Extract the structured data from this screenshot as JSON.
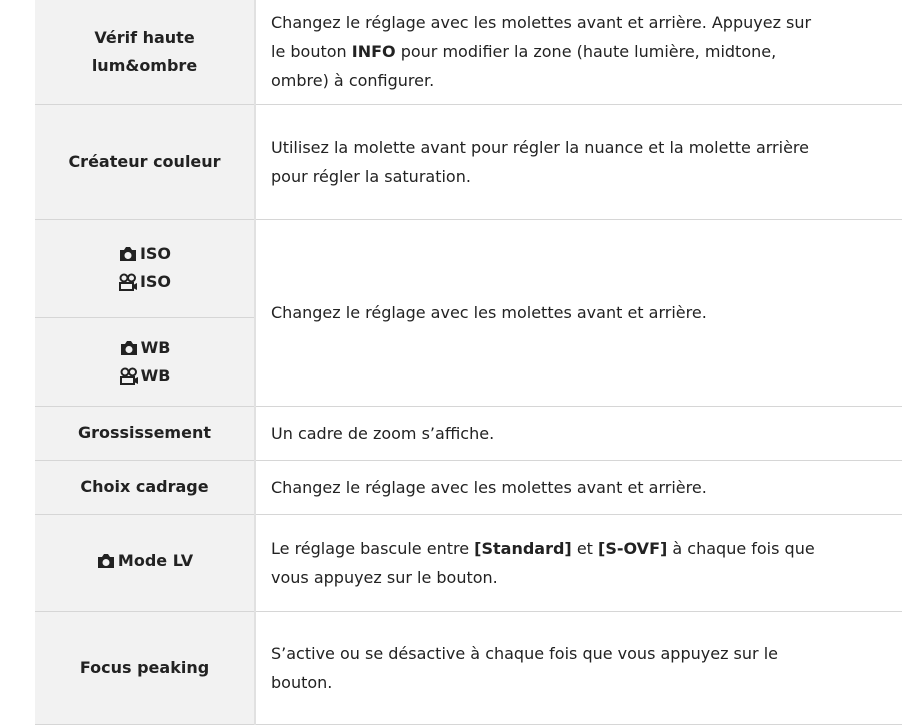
{
  "rows": [
    {
      "label_lines": [
        "Vérif haute",
        "lum&ombre"
      ],
      "desc_parts": [
        "Changez le réglage avec les molettes avant et arrière. Appuyez sur",
        "le bouton ",
        "INFO",
        " pour modifier la zone (haute lumière, midtone,",
        "ombre) à configurer."
      ]
    },
    {
      "label": "Créateur couleur",
      "desc_lines": [
        "Utilisez la molette avant pour régler la nuance et la molette arrière",
        "pour régler la saturation."
      ]
    },
    {
      "label_iso_photo": "ISO",
      "label_iso_movie": "ISO",
      "label_wb_photo": "WB",
      "label_wb_movie": "WB",
      "desc": "Changez le réglage avec les molettes avant et arrière."
    },
    {
      "label": "Grossissement",
      "desc": "Un cadre de zoom s’affiche."
    },
    {
      "label": "Choix cadrage",
      "desc": "Changez le réglage avec les molettes avant et arrière."
    },
    {
      "label": "Mode LV",
      "desc_parts": [
        "Le réglage bascule entre ",
        "[Standard]",
        " et ",
        "[S-OVF]",
        " à chaque fois que",
        "vous appuyez sur le bouton."
      ]
    },
    {
      "label": "Focus peaking",
      "desc_lines": [
        "S’active ou se désactive à chaque fois que vous appuyez sur le",
        "bouton."
      ]
    }
  ],
  "icons": {
    "camera": "camera-icon",
    "movie": "movie-camera-icon"
  },
  "colors": {
    "label_bg": "#f2f2f2",
    "border": "#d6d6d6",
    "text": "#222222"
  }
}
